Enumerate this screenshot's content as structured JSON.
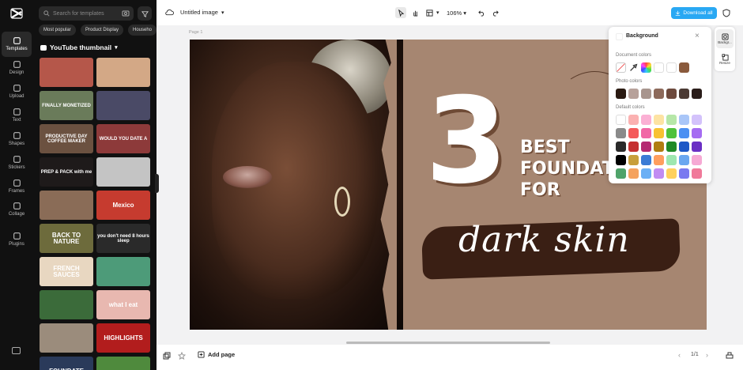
{
  "nav": {
    "items": [
      {
        "label": "Templates",
        "icon": "templates-icon"
      },
      {
        "label": "Design",
        "icon": "design-icon"
      },
      {
        "label": "Upload",
        "icon": "upload-icon"
      },
      {
        "label": "Text",
        "icon": "text-icon"
      },
      {
        "label": "Shapes",
        "icon": "shapes-icon"
      },
      {
        "label": "Stickers",
        "icon": "stickers-icon"
      },
      {
        "label": "Frames",
        "icon": "frames-icon"
      },
      {
        "label": "Collage",
        "icon": "collage-icon"
      },
      {
        "label": "Plugins",
        "icon": "plugins-icon"
      }
    ]
  },
  "panel": {
    "search_placeholder": "Search for templates",
    "chips": [
      "Most popular",
      "Product Display",
      "Househo"
    ],
    "category": "YouTube thumbnail",
    "thumbs": [
      {
        "text": "",
        "bg": "#b5574a"
      },
      {
        "text": "",
        "bg": "#d3a886"
      },
      {
        "text": "FINALLY MONETIZED",
        "bg": "#6a7b5a"
      },
      {
        "text": "",
        "bg": "#4a4a66"
      },
      {
        "text": "PRODUCTIVE DAY COFFEE MAKER",
        "bg": "#6b5140"
      },
      {
        "text": "WOULD YOU DATE A",
        "bg": "#8d3a3a"
      },
      {
        "text": "PREP & PACK with me",
        "bg": "#1e1a1a"
      },
      {
        "text": "",
        "bg": "#c4c4c4"
      },
      {
        "text": "",
        "bg": "#8a6c57"
      },
      {
        "text": "Mexico",
        "bg": "#c63b2f"
      },
      {
        "text": "BACK TO NATURE",
        "bg": "#6d6b3c"
      },
      {
        "text": "you don't need 8 hours sleep",
        "bg": "#2a2a2a"
      },
      {
        "text": "FRENCH SAUCES",
        "bg": "#e8d7c1"
      },
      {
        "text": "",
        "bg": "#4d9b79"
      },
      {
        "text": "",
        "bg": "#3b6b3a"
      },
      {
        "text": "what I eat",
        "bg": "#e8b8b0"
      },
      {
        "text": "",
        "bg": "#9b8c7c"
      },
      {
        "text": "HIGHLIGHTS",
        "bg": "#b21d1d"
      },
      {
        "text": "FOUNDATE",
        "bg": "#2a3a5a"
      },
      {
        "text": "",
        "bg": "#4f8a3d"
      }
    ]
  },
  "topbar": {
    "title": "Untitled image",
    "zoom": "106%",
    "download": "Download all"
  },
  "canvas": {
    "page_label": "Page 1",
    "big_number": "3",
    "line1": "BEST",
    "line2": "FOUNDAT",
    "line3": "FOR",
    "script": "dark skin"
  },
  "right_strip": {
    "items": [
      {
        "label": "Backgr..."
      },
      {
        "label": "Resize"
      }
    ]
  },
  "bg_popup": {
    "title": "Background",
    "document_colors_label": "Document colors",
    "photo_colors_label": "Photo colors",
    "default_colors_label": "Default colors",
    "document_colors": [
      "#ffffff",
      "#ffffff",
      "#8a5a3c"
    ],
    "photo_colors": [
      "#b7a19a",
      "#a8958e",
      "#8d6a5b",
      "#6d4a3d",
      "#4b3a33",
      "#2a1d1a"
    ],
    "default_colors": [
      "#ffffff",
      "#fbb1b1",
      "#fbb0d4",
      "#fde3a3",
      "#b6e7a8",
      "#a9c6f8",
      "#d3c2fb",
      "#8a8a8a",
      "#f45a5a",
      "#f167a6",
      "#f8c232",
      "#4fc23c",
      "#4b8ff2",
      "#a56cf2",
      "#2a2a2a",
      "#c53030",
      "#b52a72",
      "#b07d10",
      "#1f8a26",
      "#1d57c6",
      "#6a2fc4",
      "#000000",
      "#c89f3b",
      "#3a7bd5",
      "#ff9e5e",
      "#9ee7b0",
      "#6aa7f0",
      "#f6a9d4",
      "#4fa36a",
      "#f5a25d",
      "#6cb0f5",
      "#c18cf2",
      "#ffd15c",
      "#7a7af0",
      "#f07a9a"
    ]
  },
  "bottombar": {
    "add_page": "Add page",
    "page_count": "1/1"
  }
}
